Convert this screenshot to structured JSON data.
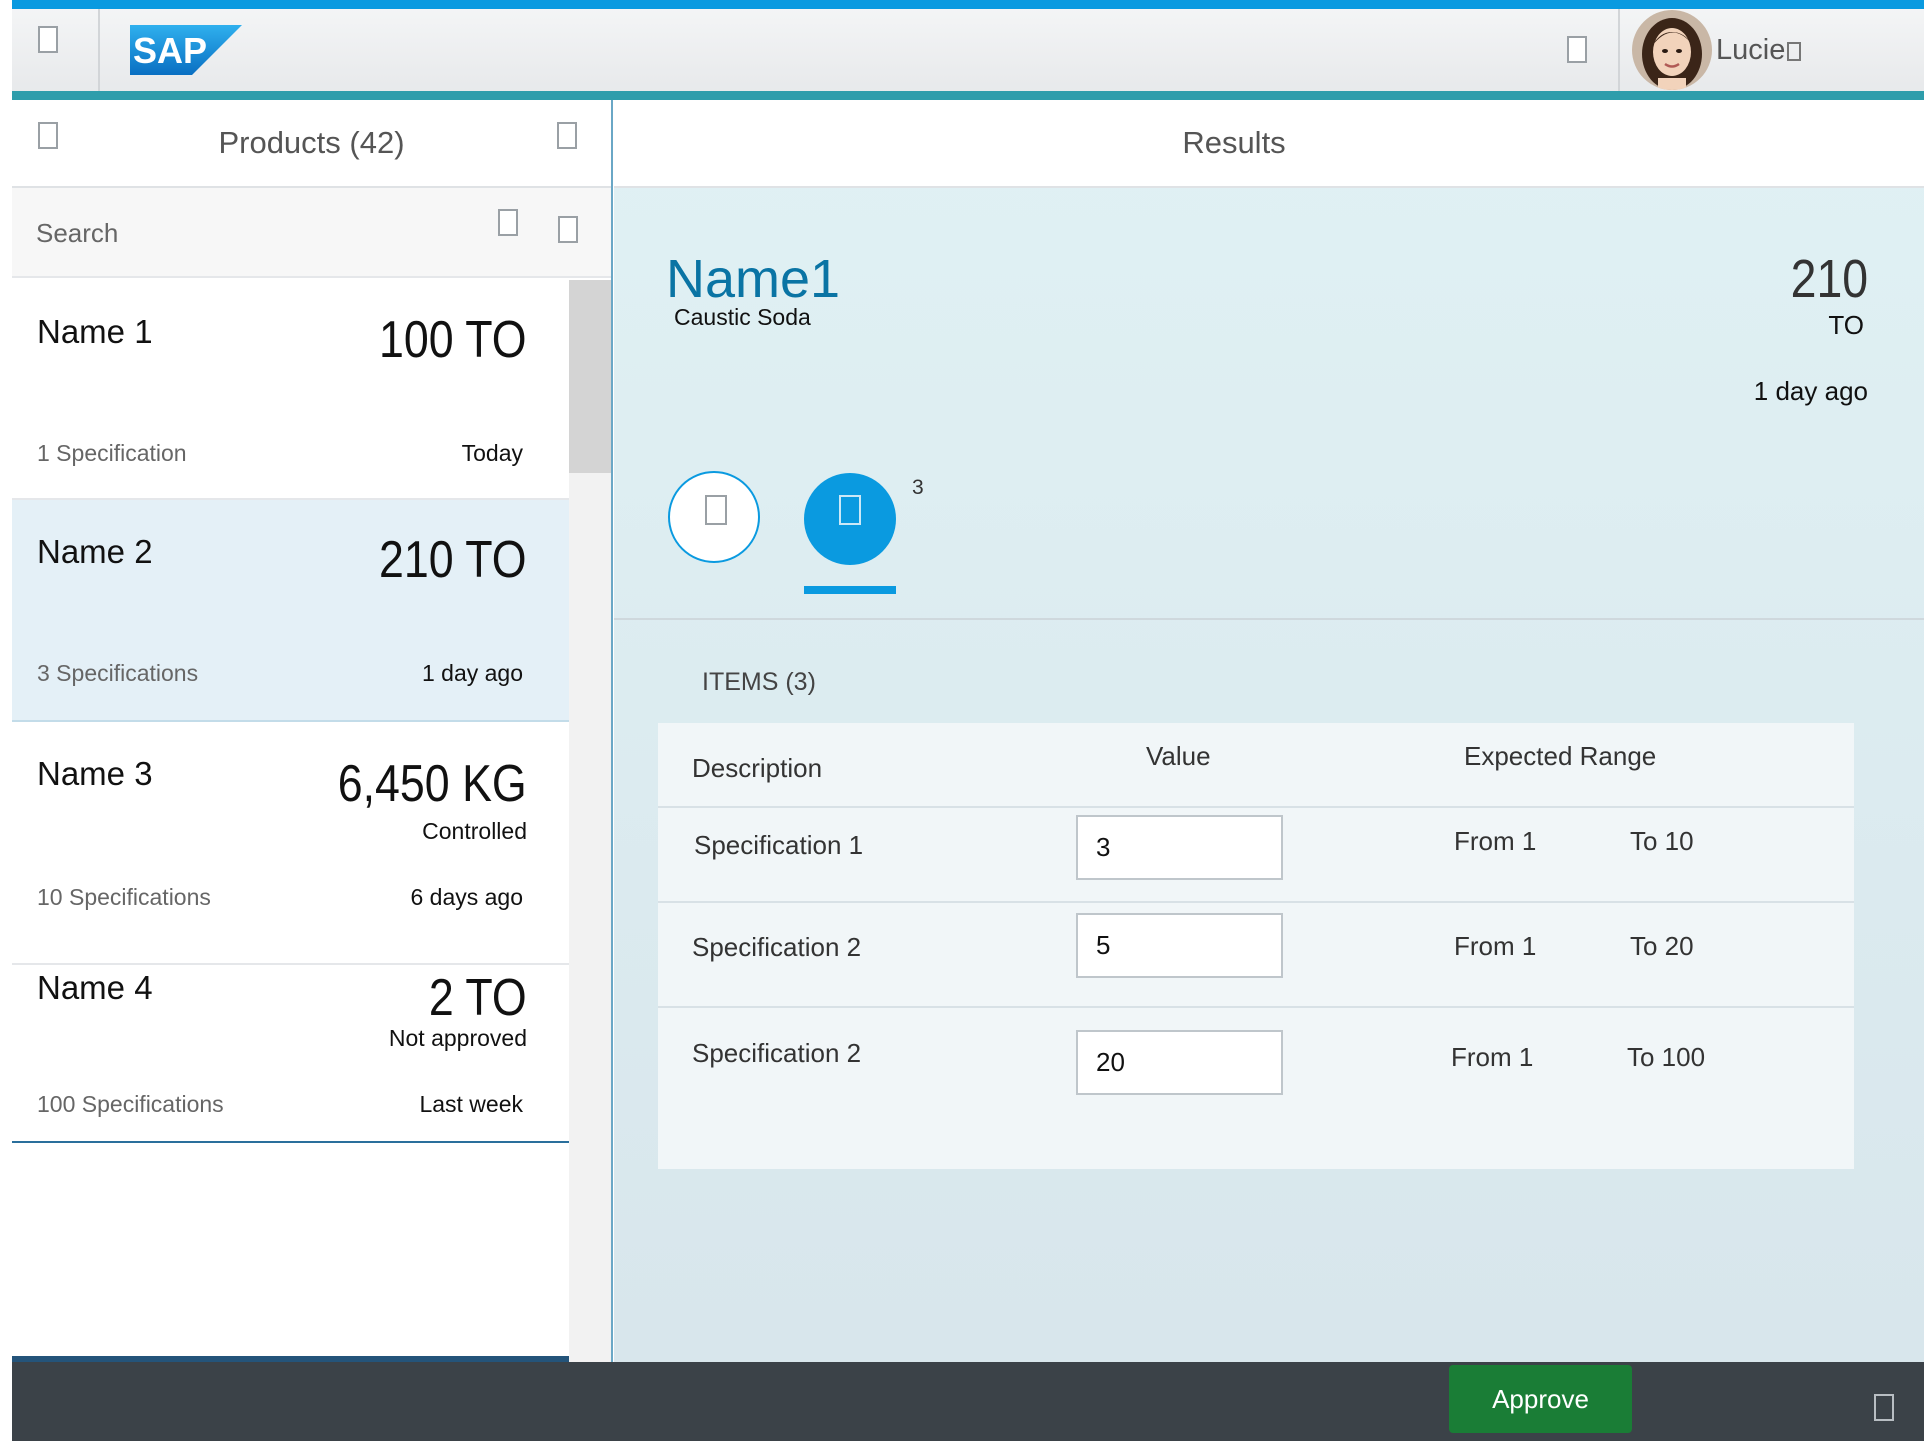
{
  "shell": {
    "logo_text": "SAP",
    "user_name": "Lucie",
    "icons": {
      "menu": "menu-icon",
      "notifications": "bell-icon",
      "user_menu": "chevron-down-icon"
    }
  },
  "master": {
    "title": "Products (42)",
    "search_placeholder": "Search",
    "items": [
      {
        "name": "Name 1",
        "number": "100 TO",
        "status_line": "",
        "attribute": "1 Specification",
        "status": "Today"
      },
      {
        "name": "Name 2",
        "number": "210 TO",
        "status_line": "",
        "attribute": "3 Specifications",
        "status": "1 day ago"
      },
      {
        "name": "Name 3",
        "number": "6,450 KG",
        "status_line": "Controlled",
        "attribute": "10 Specifications",
        "status": "6 days ago"
      },
      {
        "name": "Name 4",
        "number": "2 TO",
        "status_line": "Not approved",
        "attribute": "100 Specifications",
        "status": "Last week"
      }
    ]
  },
  "detail": {
    "title": "Results",
    "object": {
      "title": "Name1",
      "subtitle": "Caustic Soda",
      "number": "210",
      "unit": "TO",
      "status": "1 day ago"
    },
    "tabs": {
      "items_count": "3"
    },
    "items_title": "ITEMS (3)",
    "table": {
      "headers": {
        "description": "Description",
        "value": "Value",
        "range": "Expected Range"
      },
      "rows": [
        {
          "description": "Specification 1",
          "value": "3",
          "from": "From 1",
          "to": "To 10"
        },
        {
          "description": "Specification 2",
          "value": "5",
          "from": "From 1",
          "to": "To 20"
        },
        {
          "description": "Specification 2",
          "value": "20",
          "from": "From 1",
          "to": "To 100"
        }
      ]
    }
  },
  "footer": {
    "approve_label": "Approve"
  },
  "colors": {
    "accent": "#0a9ae0",
    "title_blue": "#0a74a4",
    "approve": "#1a7d36",
    "footer": "#3b4248"
  }
}
